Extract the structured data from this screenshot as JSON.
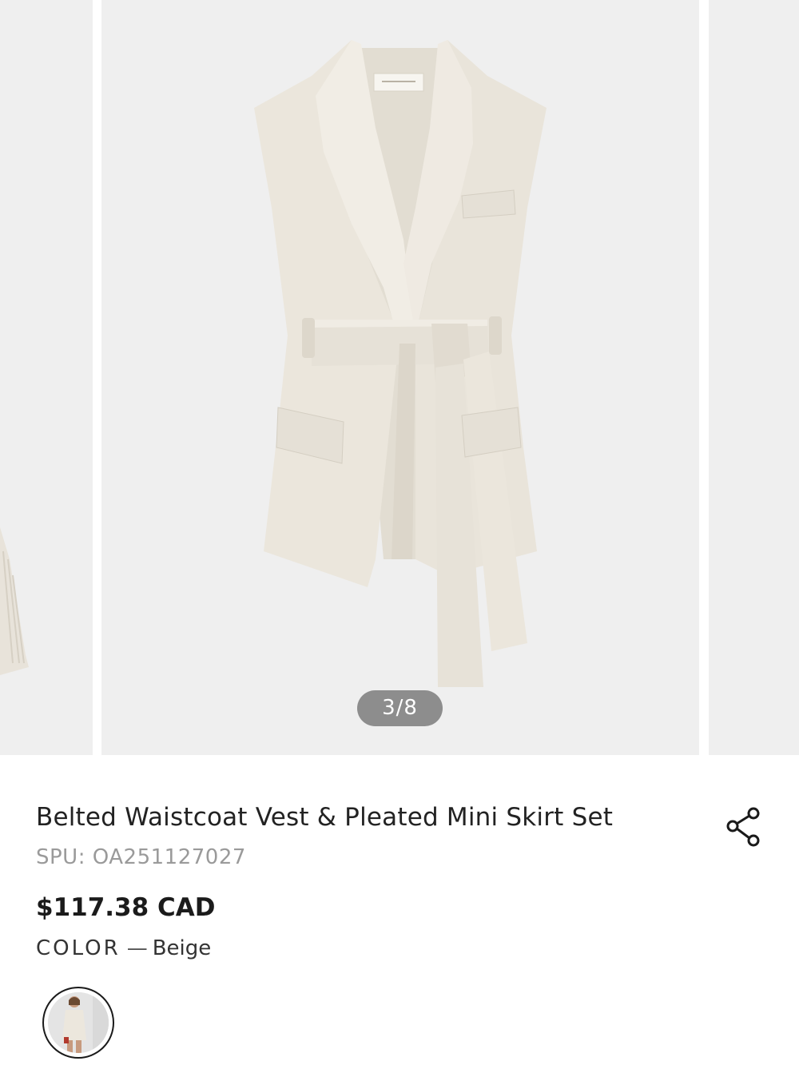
{
  "gallery": {
    "counter": "3/8",
    "current_index": 3,
    "total": 8
  },
  "product": {
    "title": "Belted Waistcoat Vest & Pleated Mini Skirt Set",
    "spu": "SPU: OA251127027",
    "price": "$117.38 CAD",
    "color_label": "COLOR",
    "color_separator": "—",
    "color_value": "Beige"
  },
  "icons": {
    "share": "share-icon"
  },
  "colors": {
    "image_background": "#efefef",
    "counter_background": "#8d8d8d",
    "garment": "#ebe6dc",
    "text_primary": "#222222",
    "text_secondary": "#9a9a9a"
  }
}
